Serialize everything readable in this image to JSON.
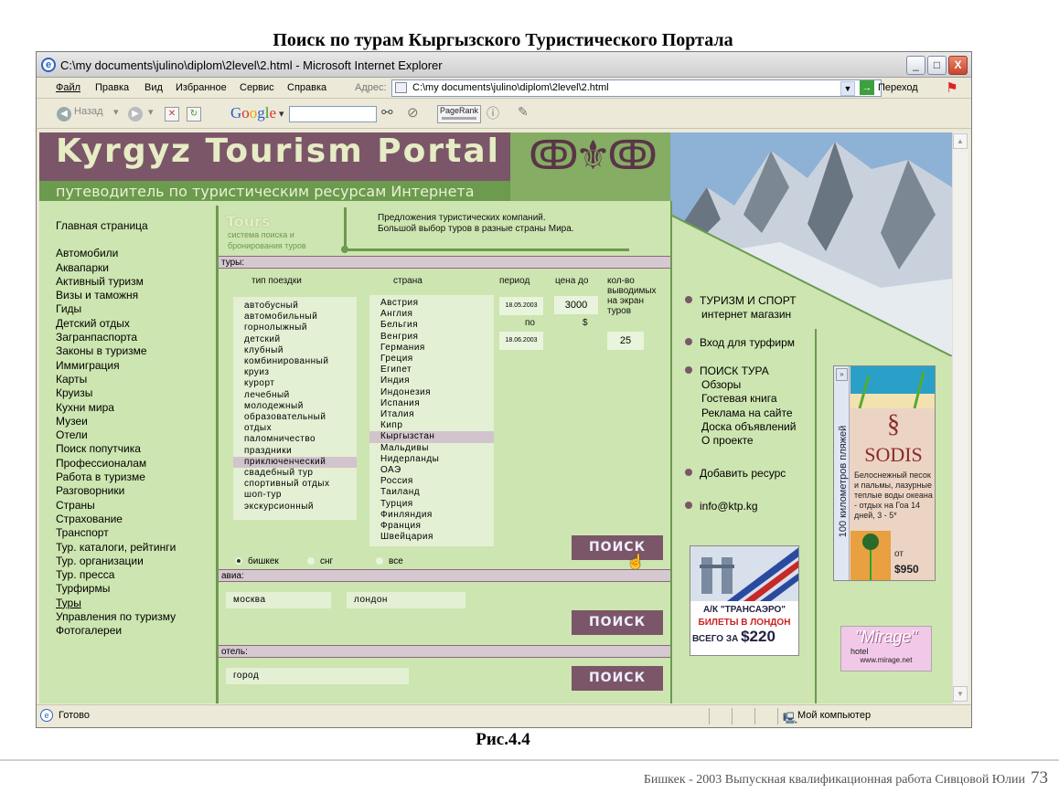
{
  "doc": {
    "title": "Поиск по турам Кыргызского Туристического Портала",
    "caption": "Рис.4.4",
    "footer_text": "Бишкек - 2003    Выпускная квалификационная работа Сивцовой Юлии",
    "page_number": "73"
  },
  "window": {
    "title": "C:\\my documents\\julino\\diplom\\2level\\2.html - Microsoft Internet Explorer",
    "controls": {
      "minimize": "_",
      "maximize": "□",
      "close": "X"
    }
  },
  "menu": [
    "Файл",
    "Правка",
    "Вид",
    "Избранное",
    "Сервис",
    "Справка"
  ],
  "address": {
    "label": "Адрес:",
    "value": "C:\\my documents\\julino\\diplom\\2level\\2.html",
    "go_label": "Переход"
  },
  "toolbar": {
    "back": "Назад",
    "google": "Google",
    "pagerank": "PageRank"
  },
  "status": {
    "text": "Готово",
    "zone": "Мой компьютер"
  },
  "site": {
    "logo": "Kyrgyz Tourism Portal",
    "tagline": "путеводитель по туристическим ресурсам Интернета",
    "ornament": "ↂ⚜ↂ",
    "tours_logo": "Tours",
    "tours_sub1": "система поиска и",
    "tours_sub2": "бронирования туров",
    "offer_line1": "Предложения туристических компаний.",
    "offer_line2": "Большой выбор туров в разные страны Мира."
  },
  "left_nav": {
    "home": "Главная страница",
    "items": [
      "Автомобили",
      "Аквапарки",
      "Активный туризм",
      "Визы и таможня",
      "Гиды",
      "Детский отдых",
      "Загранпаспорта",
      "Законы в туризме",
      "Иммиграция",
      "Карты",
      "Круизы",
      "Кухни мира",
      "Музеи",
      "Отели",
      "Поиск попутчика",
      "Профессионалам",
      "Работа в туризме",
      "Разговорники",
      "Страны",
      "Страхование",
      "Транспорт",
      "Тур. каталоги, рейтинги",
      "Тур. организации",
      "Тур. пресса",
      "Турфирмы",
      "Туры",
      "Управления по туризму",
      "Фотогалереи"
    ]
  },
  "tours_search": {
    "section_label": "туры:",
    "col_trip_type": "тип поездки",
    "col_country": "страна",
    "col_period": "период",
    "col_price": "цена до",
    "col_count_1": "кол-во",
    "col_count_2": "выводимых",
    "col_count_3": "на экран",
    "col_count_4": "туров",
    "trip_types": [
      "автобусный",
      "автомобильный",
      "горнолыжный",
      "детский",
      "клубный",
      "комбинированный",
      "круиз",
      "курорт",
      "лечебный",
      "молодежный",
      "образовательный",
      "отдых",
      "паломничество",
      "праздники",
      "приключенческий",
      "свадебный тур",
      "спортивный отдых",
      "шоп-тур",
      "экскурсионный"
    ],
    "trip_type_selected": "приключенческий",
    "countries": [
      "Австрия",
      "Англия",
      "Бельгия",
      "Венгрия",
      "Германия",
      "Греция",
      "Египет",
      "Индия",
      "Индонезия",
      "Испания",
      "Италия",
      "Кипр",
      "Кыргызстан",
      "Мальдивы",
      "Нидерланды",
      "ОАЭ",
      "Россия",
      "Таиланд",
      "Турция",
      "Финляндия",
      "Франция",
      "Швейцария"
    ],
    "country_selected": "Кыргызстан",
    "date_from": "18.05.2003",
    "date_to_label": "по",
    "date_to": "18.06.2003",
    "price": "3000",
    "currency": "$",
    "count": "25",
    "radio_options": [
      "бишкек",
      "снг",
      "все"
    ],
    "radio_selected": "бишкек",
    "search_button": "ПОИСК"
  },
  "avia": {
    "section_label": "авиа:",
    "from": "москва",
    "to": "лондон",
    "search_button": "ПОИСК"
  },
  "hotel": {
    "section_label": "отель:",
    "city": "город",
    "search_button": "ПОИСК"
  },
  "right_links": {
    "sport_1": "ТУРИЗМ И СПОРТ",
    "sport_2": "интернет магазин",
    "firms": "Вход для турфирм",
    "search_tour": "ПОИСК ТУРА",
    "sub": [
      "Обзоры",
      "Гостевая книга",
      "Реклама на сайте",
      "Доска объявлений",
      "О проекте"
    ],
    "add": "Добавить ресурс",
    "email": "info@ktp.kg"
  },
  "ads": {
    "transaero_1": "А/К \"ТРАНСАЭРО\"",
    "transaero_2": "БИЛЕТЫ В ЛОНДОН",
    "transaero_3": "ВСЕГО ЗА",
    "transaero_price": "$220",
    "sodis_vertical": "100 километров пляжей",
    "sodis_logo": "SODIS",
    "sodis_text": "Белоснежный песок и пальмы, лазурные теплые воды океана - отдых на Гоа 14 дней, 3 - 5*",
    "sodis_from": "от",
    "sodis_price": "$950",
    "mirage_logo": "\"Mirage\"",
    "mirage_hotel": "hotel",
    "mirage_url": "www.mirage.net"
  },
  "colors": {
    "page_bg": "#cde5b0",
    "plum": "#7b5668",
    "green": "#6c9a4e"
  }
}
